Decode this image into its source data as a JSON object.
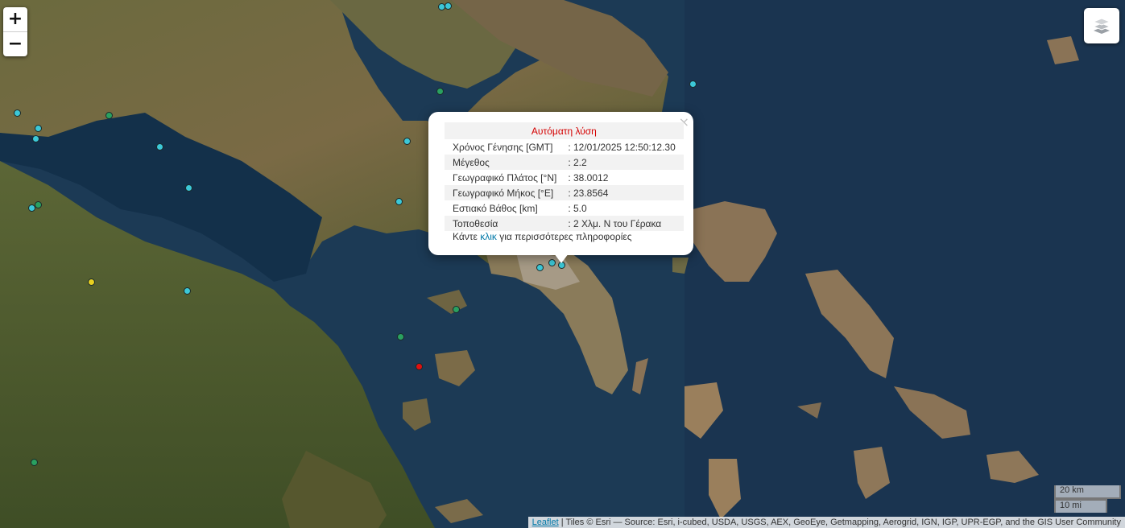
{
  "zoom": {
    "in_label": "+",
    "out_label": "−"
  },
  "layers_icon": "layers-icon",
  "popup": {
    "title": "Αυτόματη λύση",
    "rows": [
      {
        "label": "Χρόνος Γένησης [GMT]",
        "value": ": 12/01/2025 12:50:12.30"
      },
      {
        "label": "Μέγεθος",
        "value": ": 2.2"
      },
      {
        "label": "Γεωγραφικό Πλάτος [°N]",
        "value": ": 38.0012"
      },
      {
        "label": "Γεωγραφικό Μήκος [°E]",
        "value": ": 23.8564"
      },
      {
        "label": "Εστιακό Βάθος [km]",
        "value": ": 5.0"
      },
      {
        "label": "Τοποθεσία",
        "value": ": 2 Χλμ. Ν του Γέρακα"
      }
    ],
    "more_prefix": "Κάντε ",
    "more_link": "κλικ",
    "more_suffix": " για περισσότερες πληροφορίες",
    "close_label": "×"
  },
  "scale": {
    "km": "20 km",
    "mi": "10 mi"
  },
  "attribution": {
    "link": "Leaflet",
    "text": " | Tiles © Esri — Source: Esri, i-cubed, USDA, USGS, AEX, GeoEye, Getmapping, Aerogrid, IGN, IGP, UPR-EGP, and the GIS User Community"
  },
  "colors": {
    "cyan": "#3cc8d8",
    "green": "#2aa060",
    "yellow": "#e8d020",
    "red": "#e01010"
  }
}
